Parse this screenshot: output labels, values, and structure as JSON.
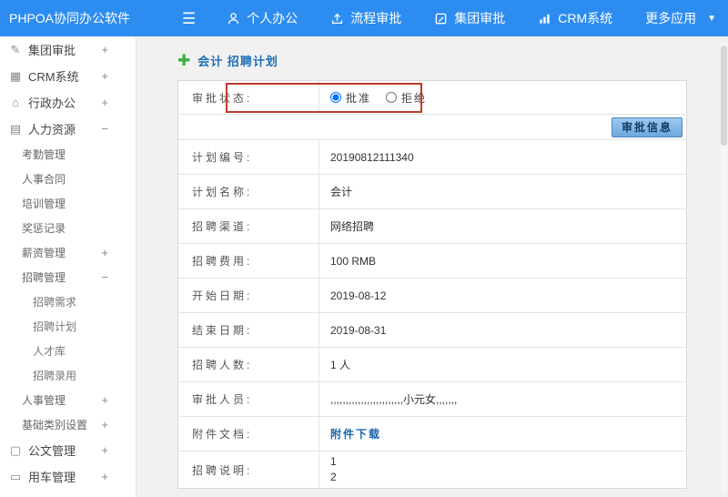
{
  "topbar": {
    "brand": "PHPOA协同办公软件",
    "items": [
      {
        "label": "个人办公",
        "icon": "person-icon"
      },
      {
        "label": "流程审批",
        "icon": "workflow-icon"
      },
      {
        "label": "集团审批",
        "icon": "approval-icon"
      },
      {
        "label": "CRM系统",
        "icon": "chart-icon"
      },
      {
        "label": "更多应用",
        "icon": "caret-down-icon"
      }
    ]
  },
  "sidebar": {
    "items": [
      {
        "label": "集团审批",
        "icon": "approval-icon",
        "toggle": "+",
        "level": 0
      },
      {
        "label": "CRM系统",
        "icon": "chart-icon",
        "toggle": "+",
        "level": 0
      },
      {
        "label": "行政办公",
        "icon": "office-icon",
        "toggle": "+",
        "level": 0
      },
      {
        "label": "人力资源",
        "icon": "hr-icon",
        "toggle": "−",
        "level": 0
      },
      {
        "label": "考勤管理",
        "level": 1
      },
      {
        "label": "人事合同",
        "level": 1
      },
      {
        "label": "培训管理",
        "level": 1
      },
      {
        "label": "奖惩记录",
        "level": 1
      },
      {
        "label": "薪资管理",
        "toggle": "+",
        "level": 1
      },
      {
        "label": "招聘管理",
        "toggle": "−",
        "level": 1
      },
      {
        "label": "招聘需求",
        "level": 2
      },
      {
        "label": "招聘计划",
        "level": 2
      },
      {
        "label": "人才库",
        "level": 2
      },
      {
        "label": "招聘录用",
        "level": 2
      },
      {
        "label": "人事管理",
        "toggle": "+",
        "level": 1
      },
      {
        "label": "基础类别设置",
        "toggle": "+",
        "level": 1
      },
      {
        "label": "公文管理",
        "icon": "document-icon",
        "toggle": "+",
        "level": 0
      },
      {
        "label": "用车管理",
        "icon": "car-icon",
        "toggle": "+",
        "level": 0
      }
    ]
  },
  "main": {
    "title": "会计 招聘计划",
    "approval": {
      "label": "审批状态:",
      "options": [
        {
          "label": "批准",
          "checked": true
        },
        {
          "label": "拒绝",
          "checked": false
        }
      ],
      "button_label": "审批信息"
    },
    "fields": [
      {
        "label": "计划编号:",
        "value": "20190812111340"
      },
      {
        "label": "计划名称:",
        "value": "会计"
      },
      {
        "label": "招聘渠道:",
        "value": "网络招聘"
      },
      {
        "label": "招聘费用:",
        "value": "100 RMB"
      },
      {
        "label": "开始日期:",
        "value": "2019-08-12"
      },
      {
        "label": "结束日期:",
        "value": "2019-08-31"
      },
      {
        "label": "招聘人数:",
        "value": "1 人"
      },
      {
        "label": "审批人员:",
        "value": ",,,,,,,,,,,,,,,,,,,,,,,,小元女,,,,,,,"
      },
      {
        "label": "附件文档:",
        "value": "附件下载",
        "type": "link"
      },
      {
        "label": "招聘说明:",
        "value": "1\n2",
        "type": "multiline"
      }
    ]
  },
  "colors": {
    "topbar_blue": "#2d8cf0",
    "title_blue": "#1f6fb5",
    "link_blue": "#1c66aa",
    "highlight_red": "#c0392b",
    "plus_green": "#3fae3f"
  }
}
